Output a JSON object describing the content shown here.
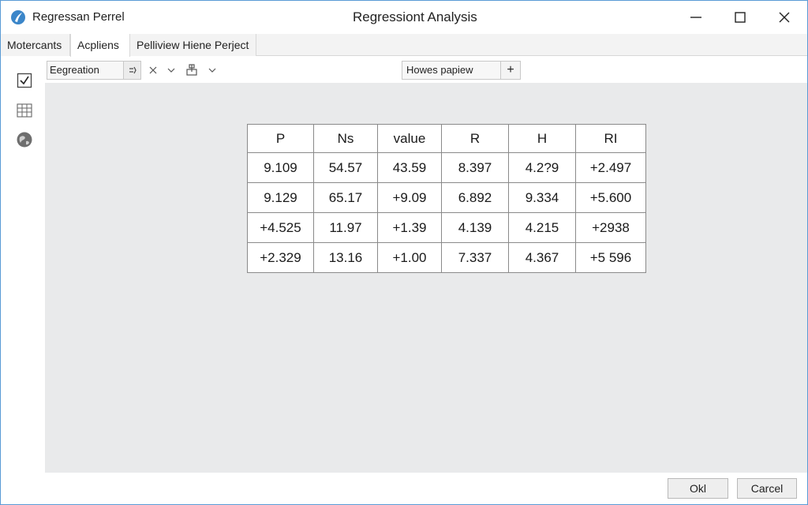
{
  "app": {
    "name": "Regressan Perrel",
    "window_title": "Regressiont Analysis",
    "accent_color": "#5a9bd5"
  },
  "tabs": [
    {
      "label": "Motercants",
      "active": false
    },
    {
      "label": "Acpliens",
      "active": true
    },
    {
      "label": "Pelliview Hiene Perject",
      "active": false
    }
  ],
  "toolbar": {
    "select_value": "Eegreation",
    "search_value": "Howes papiew",
    "add_label": "+"
  },
  "left_icons": [
    "checkbox-icon",
    "grid-icon",
    "globe-icon"
  ],
  "table": {
    "headers": [
      "P",
      "Ns",
      "value",
      "R",
      "H",
      "RI"
    ],
    "rows": [
      [
        "9.109",
        "54.57",
        "43.59",
        "8.397",
        "4.2?9",
        "+2.497"
      ],
      [
        "9.129",
        "65.17",
        "+9.09",
        "6.892",
        "9.334",
        "+5.600"
      ],
      [
        "+4.525",
        "11.97",
        "+1.39",
        "4.139",
        "4.215",
        "+2938"
      ],
      [
        "+2.329",
        "13.16",
        "+1.00",
        "7.337",
        "4.367",
        "+5 596"
      ]
    ]
  },
  "footer": {
    "ok_label": "Okl",
    "cancel_label": "Carcel"
  }
}
